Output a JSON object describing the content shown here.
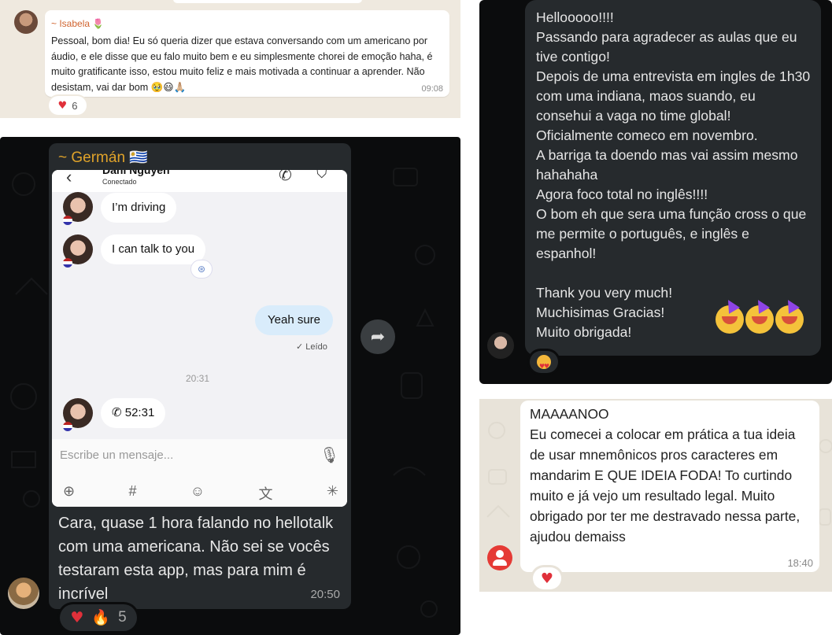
{
  "isabela": {
    "sender": "~ Isabela 🌷",
    "message": "Pessoal, bom dia! Eu só queria dizer que estava conversando com um americano por áudio, e ele disse que eu falo muito bem e eu simplesmente chorei de emoção  haha, é muito gratificante isso, estou muito feliz e mais motivada a continuar a aprender. Não desistam, vai dar bom 🥹😃🙏🏼",
    "time": "09:08",
    "reaction_count": "6"
  },
  "german": {
    "sender": "~ Germán 🇺🇾",
    "screenshot": {
      "contact_name": "Dani Nguyen",
      "status": "Conectado",
      "messages": [
        "I’m driving",
        "I can talk to you"
      ],
      "reply": "Yeah sure",
      "read_status": "Leído",
      "divider_time": "20:31",
      "call_duration": "52:31",
      "input_placeholder": "Escribe un mensaje..."
    },
    "message": "Cara, quase 1 hora falando no hellotalk com uma americana. Não sei se vocês testaram esta app, mas para mim é incrível",
    "time": "20:50",
    "reaction_count": "5"
  },
  "thanks": {
    "lines": [
      "Hellooooo!!!!",
      "Passando para agradecer as aulas que eu tive contigo!",
      "Depois de uma entrevista em ingles de 1h30 com uma indiana, maos suando, eu consehui a vaga no time global!",
      "Oficialmente comeco em novembro.",
      "A barriga ta doendo mas vai assim mesmo hahahaha",
      "Agora foco total no inglês!!!!",
      "O bom eh que sera uma função cross o que me permite o português, e inglês e espanhol!"
    ],
    "closing": [
      "Thank you very much!",
      "Muchisimas Gracias!",
      "Muito obrigada!"
    ]
  },
  "mandarim": {
    "title": "MAAAANOO",
    "message": "Eu comecei a colocar em prática a tua ideia de usar mnemônicos pros caracteres em mandarim E QUE IDEIA FODA! To curtindo muito e já vejo um resultado legal. Muito obrigado por ter me destravado nessa parte, ajudou demaiss",
    "time": "18:40"
  }
}
